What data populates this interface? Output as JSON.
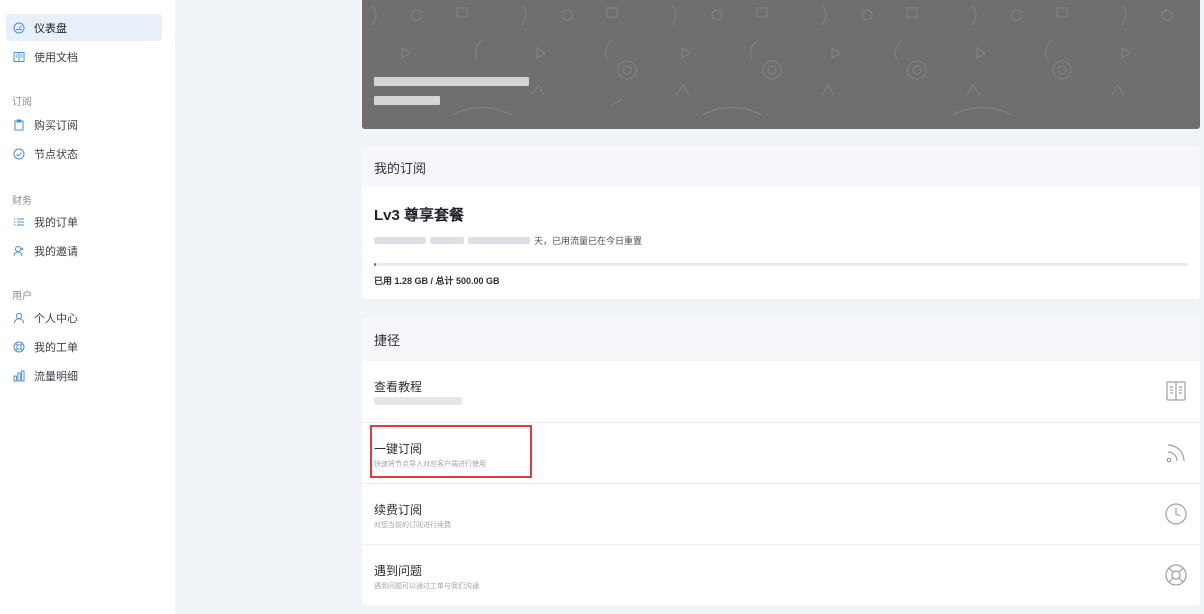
{
  "sidebar": {
    "items": [
      {
        "label": "仪表盘",
        "icon": "dashboard-icon",
        "active": true
      },
      {
        "label": "使用文档",
        "icon": "book-icon",
        "active": false
      }
    ],
    "groups": [
      {
        "label": "订阅",
        "items": [
          {
            "label": "购买订阅",
            "icon": "clipboard-icon"
          },
          {
            "label": "节点状态",
            "icon": "check-circle-icon"
          }
        ]
      },
      {
        "label": "财务",
        "items": [
          {
            "label": "我的订单",
            "icon": "list-icon"
          },
          {
            "label": "我的邀请",
            "icon": "invite-user-icon"
          }
        ]
      },
      {
        "label": "用户",
        "items": [
          {
            "label": "个人中心",
            "icon": "user-icon"
          },
          {
            "label": "我的工单",
            "icon": "support-icon"
          },
          {
            "label": "流量明细",
            "icon": "bar-chart-icon"
          }
        ]
      }
    ]
  },
  "subscription": {
    "header": "我的订阅",
    "plan_name": "Lv3 尊享套餐",
    "desc_suffix": "天，已用流量已在今日重置",
    "usage_fraction": 0.00256,
    "usage_text": "已用 1.28 GB / 总计 500.00 GB"
  },
  "shortcuts": {
    "header": "捷径",
    "items": [
      {
        "title": "查看教程",
        "desc": "",
        "icon": "book-open-icon"
      },
      {
        "title": "一键订阅",
        "desc": "快速将节点导入对应客户端进行使用",
        "icon": "rss-icon"
      },
      {
        "title": "续费订阅",
        "desc": "对您当前的订阅进行续费",
        "icon": "clock-icon"
      },
      {
        "title": "遇到问题",
        "desc": "遇到问题可以通过工单与我们沟通",
        "icon": "lifebuoy-icon"
      }
    ]
  },
  "colors": {
    "accent": "#3f7fd2",
    "highlight": "#e33b3b",
    "hero_bg": "#6f6f6f"
  }
}
